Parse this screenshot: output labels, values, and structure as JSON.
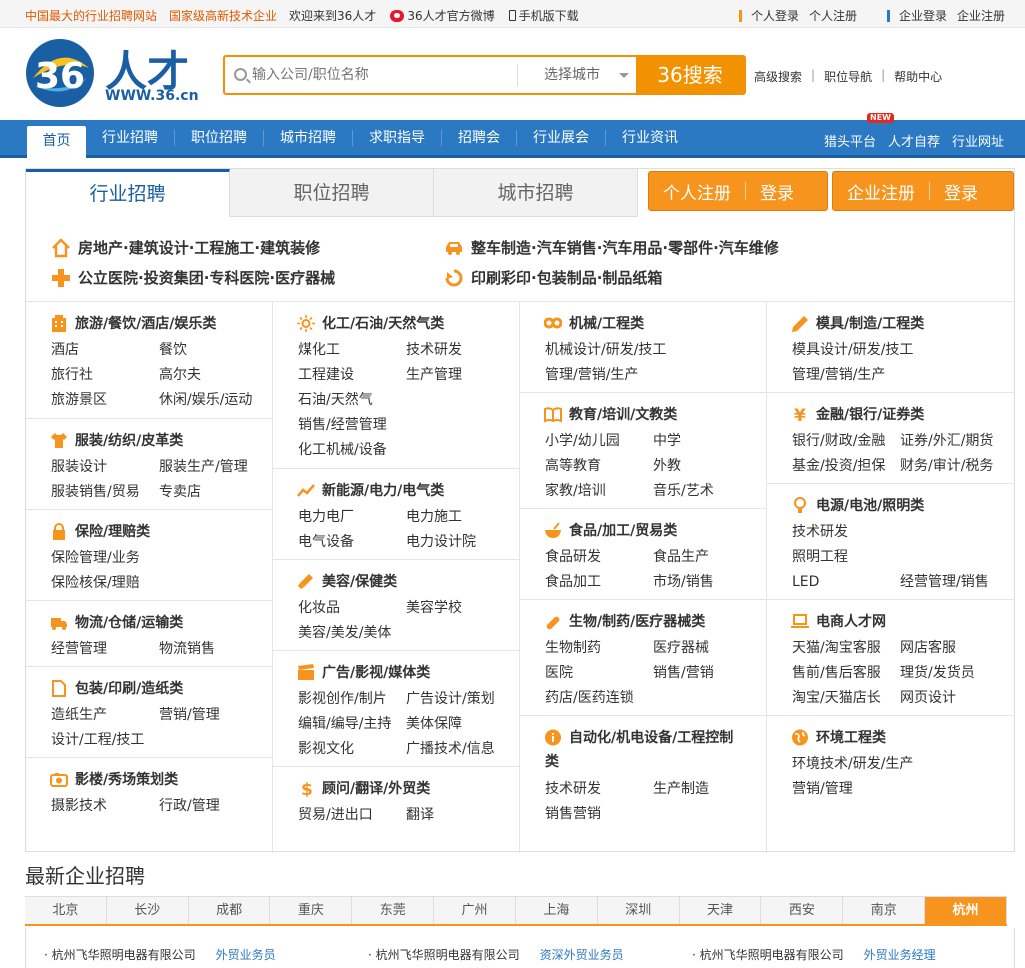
{
  "topbar": {
    "slogan1": "中国最大的行业招聘网站",
    "slogan2": "国家级高新技术企业",
    "welcome": "欢迎来到36人才",
    "weibo": "36人才官方微博",
    "mobile": "手机版下载",
    "personal_login": "个人登录",
    "personal_register": "个人注册",
    "company_login": "企业登录",
    "company_register": "企业注册"
  },
  "header": {
    "logo_text": "人才",
    "logo_url_text": "WWW.36.cn",
    "search_placeholder": "输入公司/职位名称",
    "city_select": "选择城市",
    "search_button": "36搜索",
    "advanced": "高级搜索",
    "job_nav": "职位导航",
    "help": "帮助中心"
  },
  "nav": {
    "home": "首页",
    "items": [
      "行业招聘",
      "职位招聘",
      "城市招聘",
      "求职指导",
      "招聘会",
      "行业展会",
      "行业资讯"
    ],
    "right": [
      "猎头平台",
      "人才自荐",
      "行业网址"
    ],
    "new_badge": "NEW"
  },
  "tabs": [
    "行业招聘",
    "职位招聘",
    "城市招聘"
  ],
  "register": {
    "personal_register": "个人注册",
    "personal_login": "登录",
    "company_register": "企业注册",
    "company_login": "登录"
  },
  "featured": [
    {
      "icon": "house-icon",
      "text": "房地产·建筑设计·工程施工·建筑装修"
    },
    {
      "icon": "car-icon",
      "text": "整车制造·汽车销售·汽车用品·零部件·汽车维修"
    },
    {
      "icon": "cross-icon",
      "text": "公立医院·投资集团·专科医院·医疗器械"
    },
    {
      "icon": "print-icon",
      "text": "印刷彩印·包装制品·制品纸箱"
    }
  ],
  "categories": {
    "c1": {
      "title": "旅游/餐饮/酒店/娱乐类",
      "items": [
        "酒店",
        "餐饮",
        "旅行社",
        "高尔夫",
        "旅游景区",
        "休闲/娱乐/运动"
      ]
    },
    "c2": {
      "title": "服装/纺织/皮革类",
      "items": [
        "服装设计",
        "服装生产/管理",
        "服装销售/贸易",
        "专卖店"
      ]
    },
    "c3": {
      "title": "保险/理赔类",
      "items": [
        "保险管理/业务",
        "保险核保/理赔"
      ]
    },
    "c4": {
      "title": "物流/仓储/运输类",
      "items": [
        "经营管理",
        "物流销售"
      ]
    },
    "c5": {
      "title": "包装/印刷/造纸类",
      "items": [
        "造纸生产",
        "营销/管理",
        "设计/工程/技工"
      ]
    },
    "c6": {
      "title": "影楼/秀场策划类",
      "items": [
        "摄影技术",
        "行政/管理"
      ]
    },
    "c7": {
      "title": "化工/石油/天然气类",
      "items": [
        "煤化工",
        "技术研发",
        "工程建设",
        "生产管理",
        "石油/天然气",
        "销售/经营管理",
        "化工机械/设备"
      ]
    },
    "c8": {
      "title": "新能源/电力/电气类",
      "items": [
        "电力电厂",
        "电力施工",
        "电气设备",
        "电力设计院"
      ]
    },
    "c9": {
      "title": "美容/保健类",
      "items": [
        "化妆品",
        "美容学校",
        "美容/美发/美体"
      ]
    },
    "c10": {
      "title": "广告/影视/媒体类",
      "items": [
        "影视创作/制片",
        "广告设计/策划",
        "编辑/编导/主持",
        "美体保障",
        "影视文化",
        "广播技术/信息"
      ]
    },
    "c11": {
      "title": "顾问/翻译/外贸类",
      "items": [
        "贸易/进出口",
        "翻译"
      ]
    },
    "c12": {
      "title": "机械/工程类",
      "items": [
        "机械设计/研发/技工",
        "管理/营销/生产"
      ]
    },
    "c13": {
      "title": "教育/培训/文教类",
      "items": [
        "小学/幼儿园",
        "中学",
        "高等教育",
        "外教",
        "家教/培训",
        "音乐/艺术"
      ]
    },
    "c14": {
      "title": "食品/加工/贸易类",
      "items": [
        "食品研发",
        "食品生产",
        "食品加工",
        "市场/销售"
      ]
    },
    "c15": {
      "title": "生物/制药/医疗器械类",
      "items": [
        "生物制药",
        "医疗器械",
        "医院",
        "销售/营销",
        "药店/医药连锁"
      ]
    },
    "c16": {
      "title": "自动化/机电设备/工程控制",
      "title2": "类",
      "items": [
        "技术研发",
        "生产制造",
        "销售营销"
      ]
    },
    "c17": {
      "title": "模具/制造/工程类",
      "items": [
        "模具设计/研发/技工",
        "管理/营销/生产"
      ]
    },
    "c18": {
      "title": "金融/银行/证券类",
      "items": [
        "银行/财政/金融",
        "证券/外汇/期货",
        "基金/投资/担保",
        "财务/审计/税务"
      ]
    },
    "c19": {
      "title": "电源/电池/照明类",
      "items": [
        "技术研发",
        "照明工程",
        "LED",
        "经营管理/销售"
      ]
    },
    "c20": {
      "title": "电商人才网",
      "items": [
        "天猫/淘宝客服",
        "网店客服",
        "售前/售后客服",
        "理货/发货员",
        "淘宝/天猫店长",
        "网页设计"
      ]
    },
    "c21": {
      "title": "环境工程类",
      "items": [
        "环境技术/研发/生产",
        "营销/管理"
      ]
    }
  },
  "latest": {
    "title": "最新企业招聘",
    "cities": [
      "北京",
      "长沙",
      "成都",
      "重庆",
      "东莞",
      "广州",
      "上海",
      "深圳",
      "天津",
      "西安",
      "南京",
      "杭州"
    ],
    "active_city": "杭州",
    "jobs": [
      {
        "company": "杭州飞华照明电器有限公司",
        "position": "外贸业务员"
      },
      {
        "company": "杭州飞华照明电器有限公司",
        "position": "资深外贸业务员"
      },
      {
        "company": "杭州飞华照明电器有限公司",
        "position": "外贸业务经理"
      }
    ]
  },
  "colors": {
    "brand_blue": "#2a79c2",
    "accent_orange": "#f29200"
  }
}
